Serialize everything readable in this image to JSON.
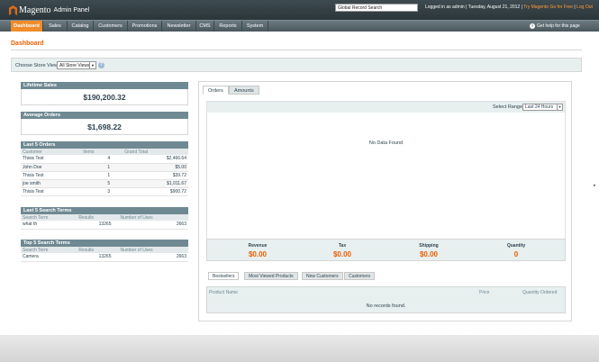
{
  "header": {
    "app_name": "Magento",
    "app_sub": "Admin Panel",
    "search_value": "Global Record Search",
    "logged_in": "Logged in as admin",
    "date": "Tuesday, August 21, 2012",
    "try_link": "Try Magento Go for Free",
    "logout": "Log Out"
  },
  "nav": [
    "Dashboard",
    "Sales",
    "Catalog",
    "Customers",
    "Promotions",
    "Newsletter",
    "CMS",
    "Reports",
    "System"
  ],
  "help_text": "Get help for this page",
  "page_title": "Dashboard",
  "store": {
    "label": "Choose Store View:",
    "value": "All Store Views"
  },
  "lifetime_sales": {
    "title": "Lifetime Sales",
    "value": "$190,200.32"
  },
  "average_orders": {
    "title": "Average Orders",
    "value": "$1,698.22"
  },
  "last_orders": {
    "title": "Last 5 Orders",
    "headers": [
      "Customer",
      "Items",
      "Grand Total"
    ],
    "rows": [
      [
        "Thisis Test",
        "4",
        "$2,466.64"
      ],
      [
        "John Doe",
        "1",
        "$5.00"
      ],
      [
        "Thisis Test",
        "1",
        "$39.72"
      ],
      [
        "joe smith",
        "5",
        "$1,011.67"
      ],
      [
        "Thisis Test",
        "3",
        "$900.72"
      ]
    ]
  },
  "last_search": {
    "title": "Last 5 Search Terms",
    "headers": [
      "Search Term",
      "Results",
      "Number of Uses"
    ],
    "rows": [
      [
        "what th",
        "13265",
        "2663"
      ]
    ]
  },
  "top_search": {
    "title": "Top 5 Search Terms",
    "headers": [
      "Search Term",
      "Results",
      "Number of Uses"
    ],
    "rows": [
      [
        "Camera",
        "13265",
        "2663"
      ]
    ]
  },
  "chart_tabs": [
    "Orders",
    "Amounts"
  ],
  "range": {
    "label": "Select Range:",
    "value": "Last 24 Hours"
  },
  "no_data": "No Data Found",
  "totals": [
    {
      "label": "Revenue",
      "value": "$0.00"
    },
    {
      "label": "Tax",
      "value": "$0.00"
    },
    {
      "label": "Shipping",
      "value": "$0.00"
    },
    {
      "label": "Quantity",
      "value": "0"
    }
  ],
  "bottom_tabs": [
    "Bestsellers",
    "Most Viewed Products",
    "New Customers",
    "Customers"
  ],
  "products": {
    "headers": [
      "Product Name",
      "Price",
      "Quantity Ordered"
    ],
    "empty": "No records found."
  },
  "colors": {
    "accent": "#eb5e00",
    "nav_active": "#f08c2c",
    "header_bg": "#2c363a",
    "box_head": "#6f8992"
  }
}
